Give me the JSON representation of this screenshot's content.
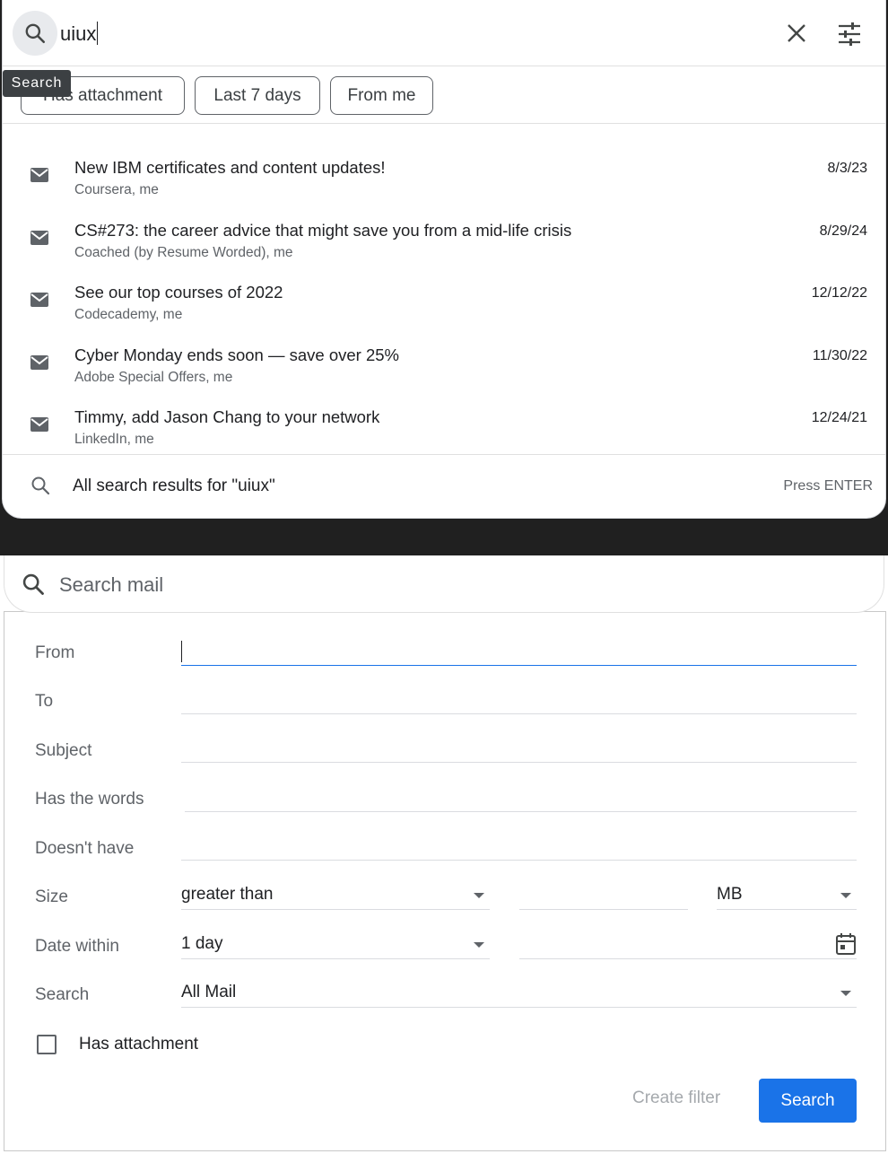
{
  "search_dropdown": {
    "query": "uiux",
    "tooltip": "Search",
    "chips": [
      "Has attachment",
      "Last 7 days",
      "From me"
    ],
    "results": [
      {
        "subject": "New IBM certificates and content updates!",
        "from": "Coursera, me",
        "date": "8/3/23"
      },
      {
        "subject": "CS#273: the career advice that might save you from a mid-life crisis",
        "from": "Coached (by Resume Worded), me",
        "date": "8/29/24"
      },
      {
        "subject": "See our top courses of 2022",
        "from": "Codecademy, me",
        "date": "12/12/22"
      },
      {
        "subject": "Cyber Monday ends soon — save over 25%",
        "from": "Adobe Special Offers, me",
        "date": "11/30/22"
      },
      {
        "subject": "Timmy, add Jason Chang to your network",
        "from": "LinkedIn, me",
        "date": "12/24/21"
      }
    ],
    "all_results_label": "All search results for \"uiux\"",
    "press_enter": "Press ENTER"
  },
  "advanced_search": {
    "search_placeholder": "Search mail",
    "labels": {
      "from": "From",
      "to": "To",
      "subject": "Subject",
      "has_words": "Has the words",
      "doesnt_have": "Doesn't have",
      "size": "Size",
      "date_within": "Date within",
      "search": "Search"
    },
    "size_operator": "greater than",
    "size_unit": "MB",
    "date_within_value": "1 day",
    "search_scope": "All Mail",
    "has_attachment_label": "Has attachment",
    "create_filter_label": "Create filter",
    "search_button_label": "Search"
  },
  "colors": {
    "accent": "#1a73e8",
    "divider": "#202020"
  }
}
